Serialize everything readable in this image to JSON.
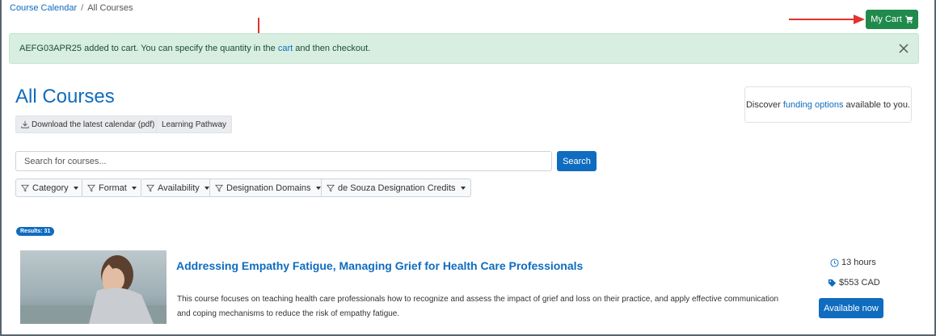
{
  "breadcrumb": {
    "root": "Course Calendar",
    "separator": "/",
    "current": "All Courses"
  },
  "cart": {
    "label": "My Cart",
    "icon": "shopping-cart-icon"
  },
  "alert": {
    "prefix": "AEFG03APR25 added to cart. You can specify the quantity in the ",
    "link": "cart",
    "suffix": " and then checkout.",
    "close_icon": "close-icon"
  },
  "page": {
    "title": "All Courses"
  },
  "actions": {
    "download_label": "Download the latest calendar (pdf)",
    "download_icon": "download-icon",
    "pathway_label": "Learning Pathway"
  },
  "funding": {
    "prefix": "Discover ",
    "link": "funding options",
    "suffix": " available to you."
  },
  "search": {
    "placeholder": "Search for courses...",
    "button_label": "Search"
  },
  "filters": [
    {
      "label": "Category"
    },
    {
      "label": "Format"
    },
    {
      "label": "Availability"
    },
    {
      "label": "Designation Domains"
    },
    {
      "label": "de Souza Designation Credits"
    }
  ],
  "results": {
    "label": "Results: 31"
  },
  "course": {
    "title": "Addressing Empathy Fatigue, Managing Grief for Health Care Professionals",
    "description": "This course focuses on teaching health care professionals how to recognize and assess the impact of grief and loss on their practice, and apply effective communication and coping mechanisms to reduce the risk of empathy fatigue.",
    "duration": "13 hours",
    "price": "$553 CAD",
    "availability_button": "Available now"
  },
  "colors": {
    "primary": "#0f6cbf",
    "success": "#1f8a4c",
    "alert_bg": "#d7eee1",
    "annotation_arrow": "#e0332b"
  }
}
